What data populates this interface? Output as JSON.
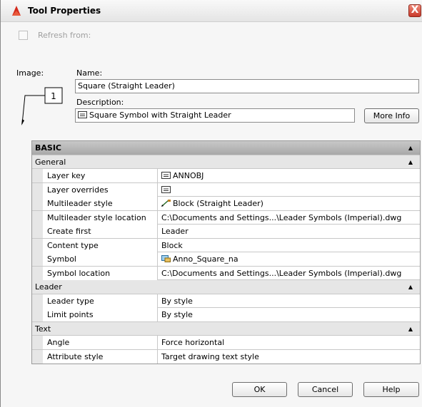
{
  "window": {
    "title": "Tool Properties",
    "close_glyph": "X"
  },
  "refresh": {
    "label": "Refresh from:",
    "checked": false
  },
  "image_label": "Image:",
  "preview": {
    "number": "1"
  },
  "name": {
    "label": "Name:",
    "value": "Square (Straight Leader)"
  },
  "description": {
    "label": "Description:",
    "value": "Square Symbol with Straight Leader"
  },
  "more_info_label": "More Info",
  "grid": {
    "basic_label": "BASIC",
    "sections": [
      {
        "label": "General",
        "rows": [
          {
            "key": "Layer key",
            "value": "ANNOBJ",
            "icon": "layer-icon"
          },
          {
            "key": "Layer overrides",
            "value": "",
            "icon": "layer-icon"
          },
          {
            "key": "Multileader style",
            "value": "Block (Straight Leader)",
            "icon": "multileader-icon"
          },
          {
            "key": "Multileader style location",
            "value": "C:\\Documents and Settings...\\Leader Symbols (Imperial).dwg"
          },
          {
            "key": "Create first",
            "value": "Leader"
          },
          {
            "key": "Content type",
            "value": "Block"
          },
          {
            "key": "Symbol",
            "value": "Anno_Square_na",
            "icon": "block-icon"
          },
          {
            "key": "Symbol location",
            "value": "C:\\Documents and Settings...\\Leader Symbols (Imperial).dwg"
          }
        ]
      },
      {
        "label": "Leader",
        "rows": [
          {
            "key": "Leader type",
            "value": "By style"
          },
          {
            "key": "Limit points",
            "value": "By style"
          }
        ]
      },
      {
        "label": "Text",
        "rows": [
          {
            "key": "Angle",
            "value": "Force horizontal"
          },
          {
            "key": "Attribute style",
            "value": "Target drawing text style"
          }
        ]
      }
    ]
  },
  "buttons": {
    "ok": "OK",
    "cancel": "Cancel",
    "help": "Help"
  }
}
